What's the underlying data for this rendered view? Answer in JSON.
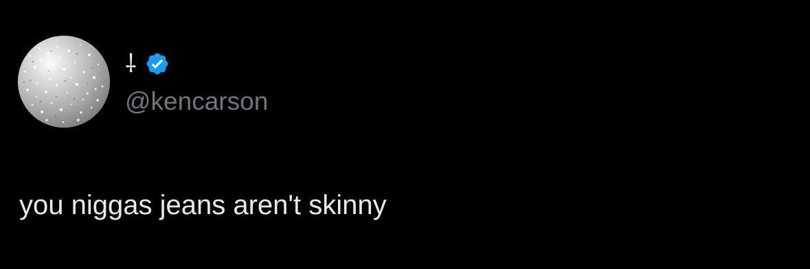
{
  "tweet": {
    "author": {
      "display_name": "⸸",
      "handle": "@kencarson",
      "verified": true,
      "avatar_icon": "glitter-avatar-icon",
      "verified_icon": "verified-badge-icon"
    },
    "text": "you niggas jeans aren't skinny"
  },
  "colors": {
    "background": "#000000",
    "primary_text": "#e7e9ea",
    "secondary_text": "#71767b",
    "verified_blue": "#1d9bf0"
  }
}
